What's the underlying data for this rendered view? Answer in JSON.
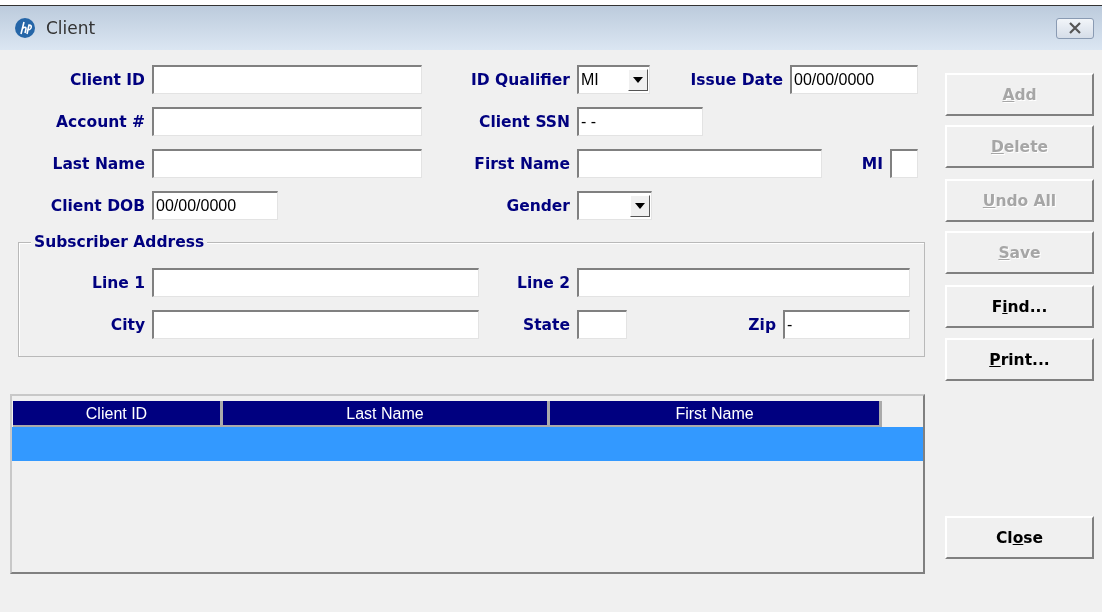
{
  "window": {
    "title": "Client"
  },
  "form_rows": [
    [
      {
        "kind": "label",
        "text": "Client ID"
      },
      {
        "kind": "text"
      },
      {
        "kind": "label",
        "text": "ID Qualifier"
      },
      {
        "kind": "combo",
        "value": "MI"
      },
      {
        "kind": "label",
        "text": "Issue Date"
      },
      {
        "kind": "text",
        "value": "00/00/0000"
      }
    ],
    [
      {
        "kind": "label",
        "text": "Account #"
      },
      {
        "kind": "text"
      },
      {
        "kind": "label",
        "text": "Client SSN"
      },
      {
        "kind": "text",
        "value": "- -"
      }
    ],
    [
      {
        "kind": "label",
        "text": "Last Name"
      },
      {
        "kind": "text"
      },
      {
        "kind": "label",
        "text": "First Name"
      },
      {
        "kind": "text"
      },
      {
        "kind": "label",
        "text": "MI"
      },
      {
        "kind": "text"
      }
    ],
    [
      {
        "kind": "label",
        "text": "Client DOB"
      },
      {
        "kind": "text",
        "value": "00/00/0000"
      },
      {
        "kind": "label",
        "text": "Gender"
      },
      {
        "kind": "combo"
      }
    ]
  ],
  "subscriber_address": {
    "title": "Subscriber Address",
    "rows": [
      [
        {
          "kind": "label",
          "text": "Line 1"
        },
        {
          "kind": "text"
        },
        {
          "kind": "label",
          "text": "Line 2"
        },
        {
          "kind": "text"
        }
      ],
      [
        {
          "kind": "label",
          "text": "City"
        },
        {
          "kind": "text"
        },
        {
          "kind": "label",
          "text": "State"
        },
        {
          "kind": "text"
        },
        {
          "kind": "label",
          "text": "Zip"
        },
        {
          "kind": "text",
          "value": "-"
        }
      ]
    ]
  },
  "table": {
    "columns": [
      "Client ID",
      "Last Name",
      "First Name"
    ],
    "rows": [
      {
        "selected": true
      }
    ]
  },
  "buttons": [
    {
      "label_parts": [
        {
          "text": "A",
          "underlined": true
        },
        {
          "text": "dd",
          "underlined": false
        }
      ],
      "disabled": true
    },
    {
      "label_parts": [
        {
          "text": "D",
          "underlined": true
        },
        {
          "text": "elete",
          "underlined": false
        }
      ],
      "disabled": true
    },
    {
      "label_parts": [
        {
          "text": "U",
          "underlined": true
        },
        {
          "text": "ndo All",
          "underlined": false
        }
      ],
      "disabled": true
    },
    {
      "label_parts": [
        {
          "text": "S",
          "underlined": true
        },
        {
          "text": "ave",
          "underlined": false
        }
      ],
      "disabled": true
    },
    {
      "label_parts": [
        {
          "text": "F",
          "underlined": false
        },
        {
          "text": "i",
          "underlined": true
        },
        {
          "text": "nd...",
          "underlined": false
        }
      ],
      "disabled": false
    },
    {
      "label_parts": [
        {
          "text": "P",
          "underlined": true
        },
        {
          "text": "rint...",
          "underlined": false
        }
      ],
      "disabled": false
    },
    {
      "label_parts": [
        {
          "text": "Cl",
          "underlined": false
        },
        {
          "text": "o",
          "underlined": true
        },
        {
          "text": "se",
          "underlined": false
        }
      ],
      "disabled": false
    }
  ]
}
